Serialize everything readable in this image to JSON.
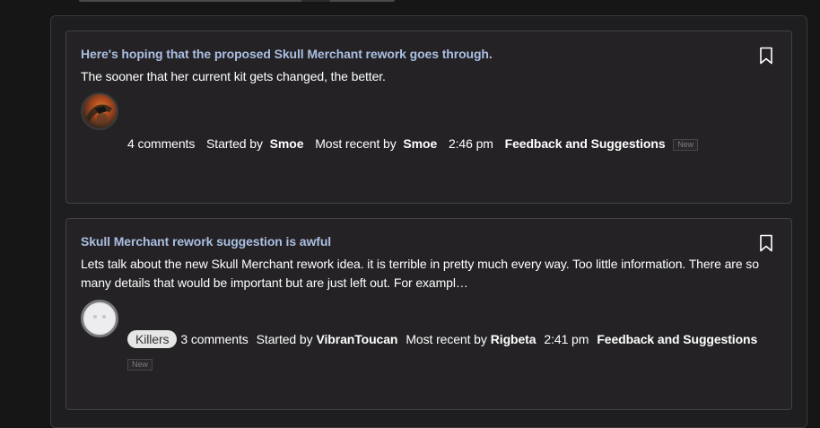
{
  "discussions": [
    {
      "title": "Here's hoping that the proposed Skull Merchant rework goes through.",
      "excerpt": "The sooner that her current kit gets changed, the better.",
      "tag": "",
      "comments": "4 comments",
      "started_by_label": "Started by",
      "author": "Smoe",
      "most_recent_label": "Most recent by",
      "last_user": "Smoe",
      "time": "2:46 pm",
      "category": "Feedback and Suggestions",
      "badge": "New"
    },
    {
      "title": "Skull Merchant rework suggestion is awful",
      "excerpt": "Lets talk about the new Skull Merchant rework idea. it is terrible in pretty much every way. Too little information. There are so many details that would be important but are just left out. For exampl…",
      "tag": "Killers",
      "comments": "3 comments",
      "started_by_label": "Started by",
      "author": "VibranToucan",
      "most_recent_label": "Most recent by",
      "last_user": "Rigbeta",
      "time": "2:41 pm",
      "category": "Feedback and Suggestions",
      "badge": "New"
    }
  ],
  "icons": {
    "bookmark": "bookmark-icon",
    "avatar_1": "user-avatar-image",
    "avatar_2": "default-avatar-icon"
  },
  "colors": {
    "page_bg": "#171617",
    "card_bg": "#242225",
    "title_link": "#aabfe2",
    "tag_pill": "#e6e6e6"
  }
}
